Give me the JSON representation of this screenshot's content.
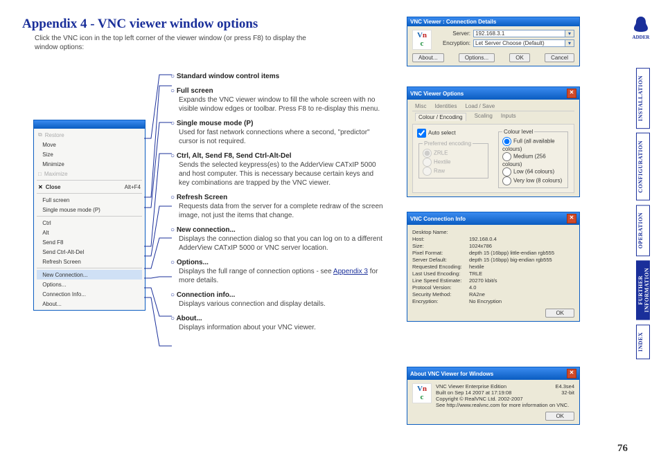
{
  "heading": "Appendix 4 - VNC viewer window options",
  "intro": "Click the VNC icon in the top left corner of the viewer window (or press F8) to display the window options:",
  "menu": {
    "restore": "Restore",
    "move": "Move",
    "size": "Size",
    "minimize": "Minimize",
    "maximize": "Maximize",
    "close": "Close",
    "close_shortcut": "Alt+F4",
    "fullscreen": "Full screen",
    "singlemouse": "Single mouse mode (P)",
    "ctrl": "Ctrl",
    "alt": "Alt",
    "sendf8": "Send F8",
    "sendcad": "Send Ctrl-Alt-Del",
    "refresh": "Refresh Screen",
    "newconn": "New Connection...",
    "options": "Options...",
    "conninfo": "Connection Info...",
    "about": "About..."
  },
  "defs": {
    "std": {
      "t": "Standard window control items"
    },
    "full": {
      "t": "Full screen",
      "d": "Expands the VNC viewer window to fill the whole screen with no visible window edges or toolbar. Press F8 to re-display this menu."
    },
    "single": {
      "t": "Single mouse mode (P)",
      "d": "Used for fast network connections where a second, \"predictor\" cursor is not required."
    },
    "cad": {
      "t": "Ctrl, Alt, Send F8, Send Ctrl-Alt-Del",
      "d": "Sends the selected keypress(es) to the AdderView CATxIP 5000 and host computer. This is necessary because certain keys and key combinations are trapped by the VNC viewer."
    },
    "refresh": {
      "t": "Refresh Screen",
      "d": "Requests data from the server for a complete redraw of the screen image, not just the items that change."
    },
    "newconn": {
      "t": "New connection...",
      "d": "Displays the connection dialog so that you can log on to a different AdderView CATxIP 5000 or VNC server location."
    },
    "options": {
      "t": "Options...",
      "d1": "Displays the full range of connection options - see ",
      "link": "Appendix 3",
      "d2": " for more details."
    },
    "conninfo": {
      "t": "Connection info...",
      "d": "Displays various connection and display details."
    },
    "about": {
      "t": "About...",
      "d": "Displays information about your VNC viewer."
    }
  },
  "dlg_conn": {
    "title": "VNC Viewer : Connection Details",
    "server_label": "Server:",
    "server_value": "192.168.3.1",
    "enc_label": "Encryption:",
    "enc_value": "Let Server Choose (Default)",
    "btn_about": "About...",
    "btn_options": "Options...",
    "btn_ok": "OK",
    "btn_cancel": "Cancel"
  },
  "dlg_opts": {
    "title": "VNC Viewer Options",
    "tab_misc": "Misc",
    "tab_ident": "Identities",
    "tab_load": "Load / Save",
    "tab_colour": "Colour / Encoding",
    "tab_scaling": "Scaling",
    "tab_inputs": "Inputs",
    "auto": "Auto select",
    "pref": "Preferred encoding",
    "zrle": "ZRLE",
    "hextile": "Hextile",
    "raw": "Raw",
    "clevel": "Colour level",
    "c_full": "Full (all available colours)",
    "c_med": "Medium (256 colours)",
    "c_low": "Low (64 colours)",
    "c_vlow": "Very low (8 colours)"
  },
  "dlg_info": {
    "title": "VNC Connection Info",
    "rows": [
      {
        "k": "Desktop Name:",
        "v": ""
      },
      {
        "k": "Host:",
        "v": "192.168.0.4"
      },
      {
        "k": "Size:",
        "v": "1024x786"
      },
      {
        "k": "Pixel Format:",
        "v": "depth 15 (16bpp) little-endian rgb555"
      },
      {
        "k": "Server Default:",
        "v": "depth 15 (16bpp) big-endian rgb555"
      },
      {
        "k": "Requested Encoding:",
        "v": "hextile"
      },
      {
        "k": "Last Used Encoding:",
        "v": "TRLE"
      },
      {
        "k": "Line Speed Estimate:",
        "v": "20270 kbit/s"
      },
      {
        "k": "Protocol Version:",
        "v": "4.0"
      },
      {
        "k": "Security Method:",
        "v": "RA2ne"
      },
      {
        "k": "Encryption:",
        "v": "No Encryption"
      }
    ],
    "btn_ok": "OK"
  },
  "dlg_about": {
    "title": "About VNC Viewer for Windows",
    "l1a": "VNC Viewer Enterprise Edition",
    "l1b": "E4.3se4",
    "l2a": "Built on Sep 14 2007 at 17:19:08",
    "l2b": "32-bit",
    "l3": "Copyright © RealVNC Ltd. 2002-2007",
    "l4": "See http://www.realvnc.com for more information on VNC.",
    "btn_ok": "OK"
  },
  "nav": {
    "install": "INSTALLATION",
    "config": "CONFIGURATION",
    "oper": "OPERATION",
    "further": "FURTHER\nINFORMATION",
    "index": "INDEX"
  },
  "brand": "ADDER",
  "page": "76"
}
